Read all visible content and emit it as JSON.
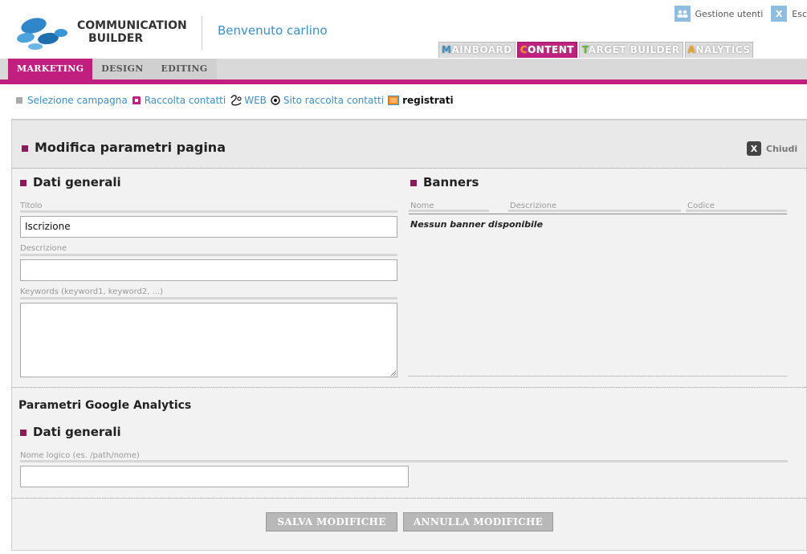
{
  "header": {
    "brand_line1": "COMMUNICATION",
    "brand_line2": "BUILDER",
    "welcome": "Benvenuto carlino",
    "user_admin_label": "Gestione utenti",
    "exit_label": "Esc"
  },
  "main_tabs": [
    {
      "label": "MAINBOARD",
      "initial_color": "#3a8fc6",
      "active": false
    },
    {
      "label": "CONTENT",
      "initial_color": "#ff8a1f",
      "active": true
    },
    {
      "label": "TARGET BUILDER",
      "initial_color": "#68b13a",
      "active": false
    },
    {
      "label": "ANALYTICS",
      "initial_color": "#f2a51a",
      "active": false
    }
  ],
  "sub_tabs": [
    {
      "label": "MARKETING",
      "active": true
    },
    {
      "label": "DESIGN",
      "active": false
    },
    {
      "label": "EDITING",
      "active": false
    }
  ],
  "breadcrumb": {
    "campaign": "Selezione campagna",
    "contacts": "Raccolta contatti",
    "web": "WEB",
    "site": "Sito raccolta contatti",
    "current": "registrati"
  },
  "panel": {
    "title": "Modifica parametri pagina",
    "close_label": "Chiudi",
    "general": {
      "title": "Dati generali",
      "title_label": "Titolo",
      "title_value": "Iscrizione",
      "description_label": "Descrizione",
      "description_value": "",
      "keywords_label": "Keywords (keyword1, keyword2, ...)",
      "keywords_value": ""
    },
    "banners": {
      "title": "Banners",
      "columns": [
        "Nome",
        "Descrizione",
        "Codice"
      ],
      "empty_message": "Nessun banner disponibile"
    },
    "ga": {
      "title": "Parametri Google Analytics",
      "general_title": "Dati generali",
      "logical_name_label": "Nome logico (es. /path/nome)",
      "logical_name_value": ""
    },
    "save_label": "SALVA MODIFICHE",
    "cancel_label": "ANNULLA MODIFICHE"
  },
  "colors": {
    "accent": "#c11f7f",
    "link": "#3a8fc6",
    "bullet": "#8b1a58"
  }
}
